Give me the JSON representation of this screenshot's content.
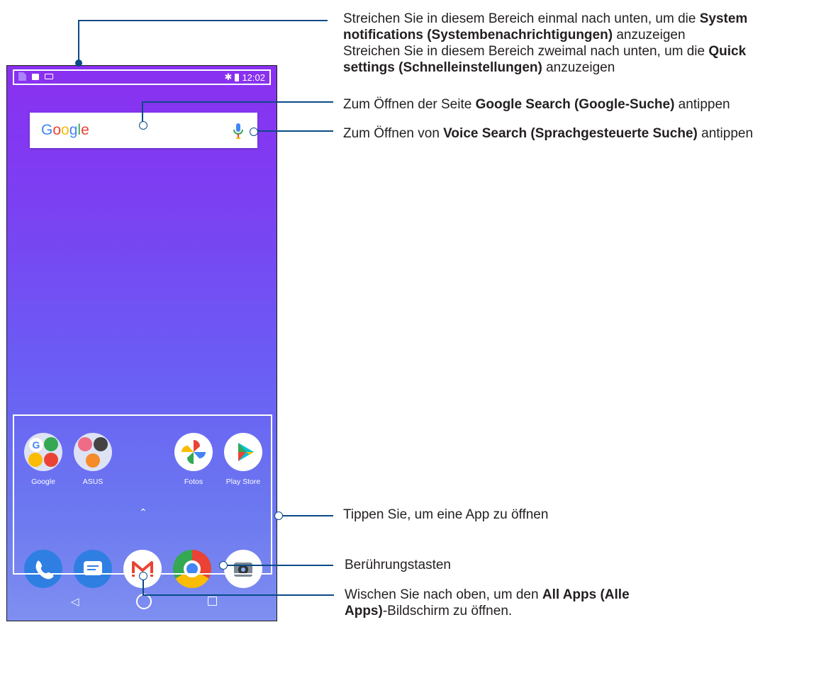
{
  "statusbar": {
    "time": "12:02",
    "bluetooth_glyph": "✱"
  },
  "search": {
    "logo": "Google"
  },
  "apps_row": [
    {
      "label": "Google"
    },
    {
      "label": "ASUS"
    },
    {
      "label": "Fotos"
    },
    {
      "label": "Play Store"
    }
  ],
  "dock": [
    "phone-icon",
    "messages-icon",
    "gmail-icon",
    "chrome-icon",
    "camera-icon"
  ],
  "nav": {
    "back_glyph": "◁",
    "up_glyph": "⌃"
  },
  "annotations": {
    "statusbar": {
      "l1a": "Streichen Sie in diesem Bereich einmal nach unten, um die ",
      "l1b": "System",
      "l2a": "notifications (Systembenachrichtigungen)",
      "l2b": " anzuzeigen",
      "l3a": "Streichen Sie in diesem Bereich zweimal nach unten, um die ",
      "l3b": "Quick",
      "l4a": "settings (Schnelleinstellungen)",
      "l4b": " anzuzeigen"
    },
    "google_search": {
      "a": "Zum Öffnen der Seite ",
      "b": "Google Search (Google-Suche)",
      "c": " antippen"
    },
    "voice_search": {
      "a": "Zum Öffnen von ",
      "b": "Voice Search (Sprachgesteuerte Suche)",
      "c": " antippen"
    },
    "apps": {
      "text": "Tippen Sie, um eine App zu öffnen"
    },
    "touch_keys": {
      "text": "Berührungstasten"
    },
    "all_apps": {
      "l1a": "Wischen Sie nach oben, um den ",
      "l1b": "All Apps (Alle",
      "l2a": "Apps)",
      "l2b": "-Bildschirm zu öffnen."
    }
  },
  "colors": {
    "callout": "#0a4a87",
    "wallpaper_top": "#8a30f0",
    "wallpaper_bottom": "#7f8ff0"
  }
}
